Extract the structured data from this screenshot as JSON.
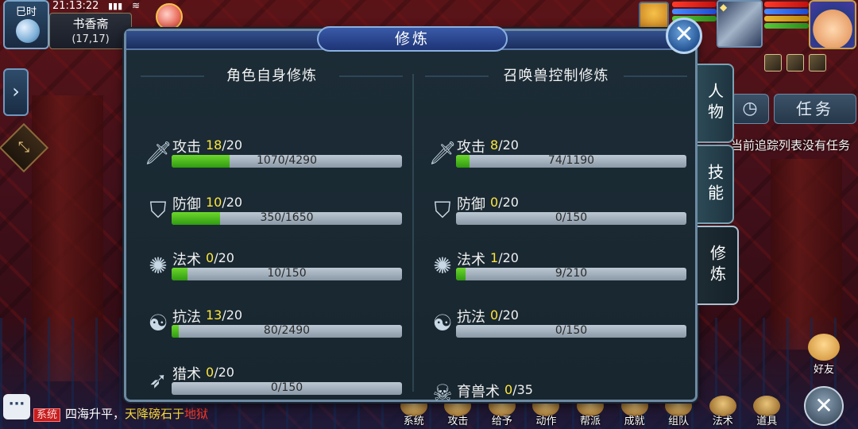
{
  "status": {
    "period": "巳时",
    "clock": "21:13:22",
    "location_name": "书香斋",
    "location_coord": "(17,17)"
  },
  "dialog": {
    "title": "修炼",
    "columns": [
      {
        "title": "角色自身修炼",
        "rows": [
          {
            "name": "攻击",
            "icon": "sword-icon",
            "level": "18",
            "max": "/20",
            "progress": "1070/4290",
            "fill": 0.25
          },
          {
            "name": "防御",
            "icon": "shield-icon",
            "level": "10",
            "max": "/20",
            "progress": "350/1650",
            "fill": 0.21
          },
          {
            "name": "法术",
            "icon": "magic-staff-icon",
            "level": "0",
            "max": "/20",
            "progress": "10/150",
            "fill": 0.07
          },
          {
            "name": "抗法",
            "icon": "yin-yang-icon",
            "level": "13",
            "max": "/20",
            "progress": "80/2490",
            "fill": 0.03
          },
          {
            "name": "猎术",
            "icon": "bow-icon",
            "level": "0",
            "max": "/20",
            "progress": "0/150",
            "fill": 0.0
          }
        ]
      },
      {
        "title": "召唤兽控制修炼",
        "rows": [
          {
            "name": "攻击",
            "icon": "sword-icon",
            "level": "8",
            "max": "/20",
            "progress": "74/1190",
            "fill": 0.06
          },
          {
            "name": "防御",
            "icon": "shield-icon",
            "level": "0",
            "max": "/20",
            "progress": "0/150",
            "fill": 0.0
          },
          {
            "name": "法术",
            "icon": "magic-staff-icon",
            "level": "1",
            "max": "/20",
            "progress": "9/210",
            "fill": 0.04
          },
          {
            "name": "抗法",
            "icon": "yin-yang-icon",
            "level": "0",
            "max": "/20",
            "progress": "0/150",
            "fill": 0.0
          },
          {
            "name": "育兽术",
            "icon": "beast-skull-icon",
            "level": "0",
            "max": "/35",
            "progress": "",
            "fill": null
          }
        ]
      }
    ],
    "tabs": [
      {
        "label": "人物",
        "active": false
      },
      {
        "label": "技能",
        "active": false
      },
      {
        "label": "修炼",
        "active": true
      }
    ]
  },
  "task_panel": {
    "task_label": "任务",
    "empty_text": "当前追踪列表没有任务"
  },
  "friend_label": "好友",
  "chat": {
    "channel": "系统",
    "segments": [
      {
        "text": "四海升平，",
        "color": "white"
      },
      {
        "text": "天降磅石于",
        "color": "yellow"
      },
      {
        "text": "地狱",
        "color": "red"
      }
    ]
  },
  "bottom_menu": [
    "系统",
    "攻击",
    "给予",
    "动作",
    "帮派",
    "成就",
    "组队",
    "法术",
    "道具"
  ],
  "colors": {
    "level_current": "#ffe63a",
    "bar_fill": "#46b61e",
    "bar_track": "#a4b2c0"
  }
}
